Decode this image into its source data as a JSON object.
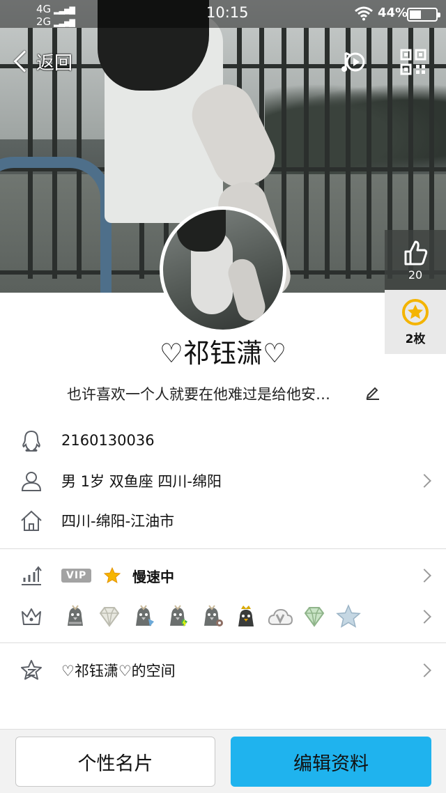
{
  "status_bar": {
    "network_1": "4G",
    "network_2": "2G",
    "time": "10:15",
    "battery_percent": "44%",
    "battery_level": 0.44
  },
  "nav": {
    "back_label": "返回",
    "music_icon": "music-play-icon",
    "qr_icon": "qr-code-icon"
  },
  "side": {
    "likes": "20",
    "medals": "2枚"
  },
  "profile": {
    "nickname": "♡祁钰潇♡",
    "signature": "也许喜欢一个人就要在他难过是给他安…"
  },
  "rows": {
    "qq_number": "2160130036",
    "basic_info": "男  1岁  双鱼座  四川-绵阳",
    "location": "四川-绵阳-江油市",
    "vip_badge": "VIP",
    "speed_status": "慢速中",
    "space_name": "♡祁钰潇♡的空间"
  },
  "buttons": {
    "card": "个性名片",
    "edit": "编辑资料"
  },
  "colors": {
    "accent": "#1fb3ee",
    "medal": "#f4b400",
    "icon_gray": "#5b5f66"
  }
}
